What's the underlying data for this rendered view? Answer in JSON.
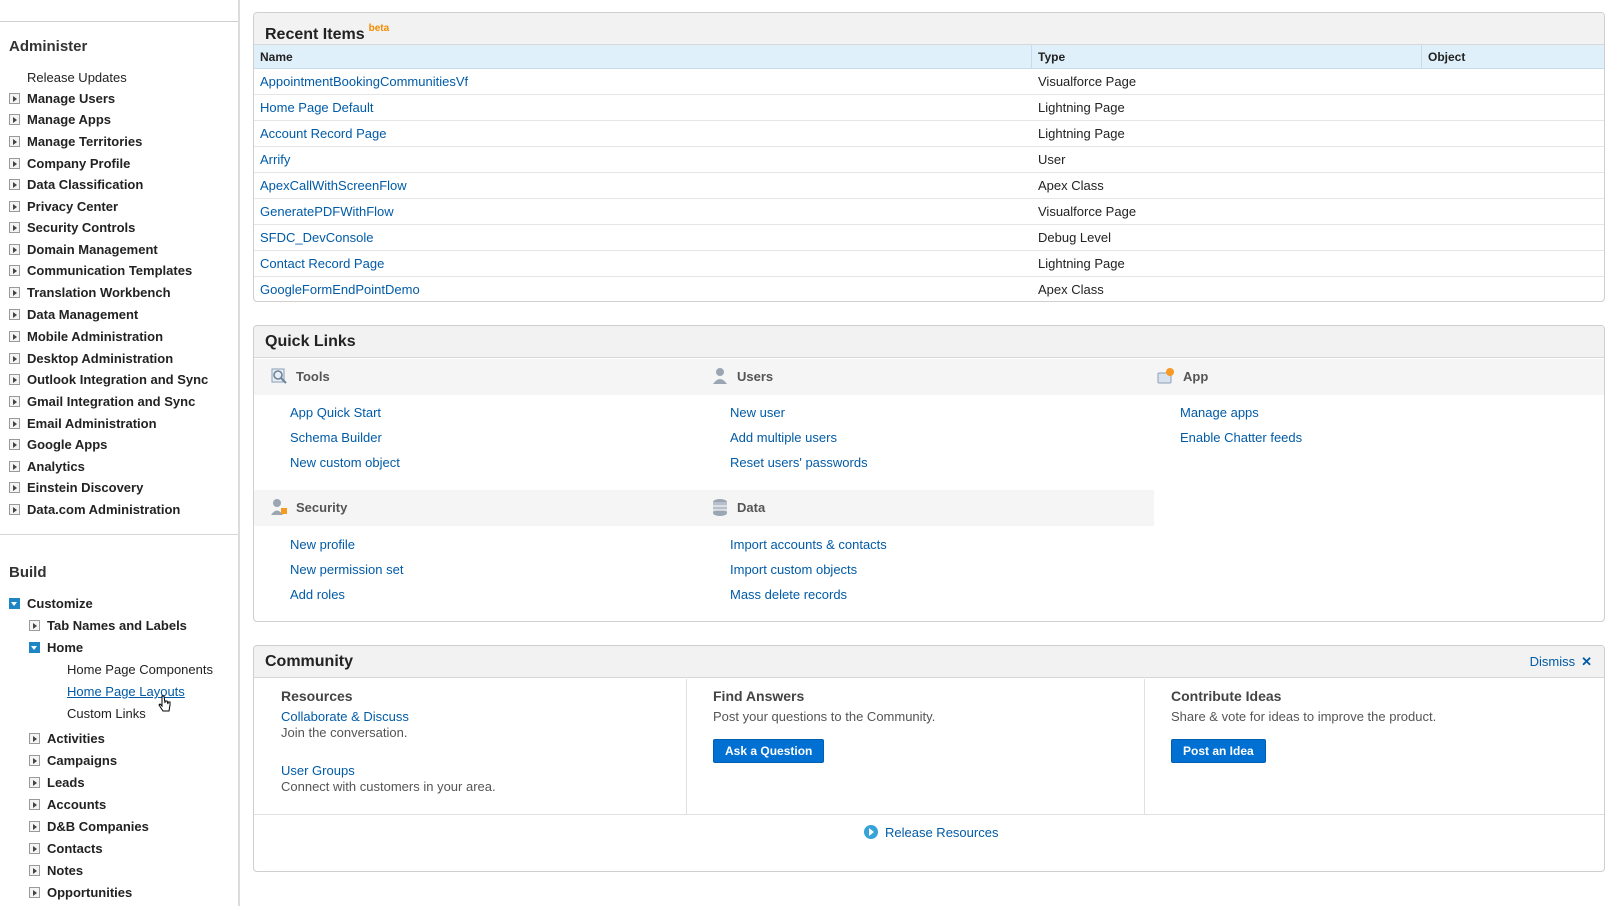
{
  "sidebar": {
    "administer_heading": "Administer",
    "administer_items": [
      {
        "label": "Release Updates",
        "toggle": false
      },
      {
        "label": "Manage Users",
        "toggle": true
      },
      {
        "label": "Manage Apps",
        "toggle": true
      },
      {
        "label": "Manage Territories",
        "toggle": true
      },
      {
        "label": "Company Profile",
        "toggle": true
      },
      {
        "label": "Data Classification",
        "toggle": true
      },
      {
        "label": "Privacy Center",
        "toggle": true
      },
      {
        "label": "Security Controls",
        "toggle": true
      },
      {
        "label": "Domain Management",
        "toggle": true
      },
      {
        "label": "Communication Templates",
        "toggle": true
      },
      {
        "label": "Translation Workbench",
        "toggle": true
      },
      {
        "label": "Data Management",
        "toggle": true
      },
      {
        "label": "Mobile Administration",
        "toggle": true
      },
      {
        "label": "Desktop Administration",
        "toggle": true
      },
      {
        "label": "Outlook Integration and Sync",
        "toggle": true
      },
      {
        "label": "Gmail Integration and Sync",
        "toggle": true
      },
      {
        "label": "Email Administration",
        "toggle": true
      },
      {
        "label": "Google Apps",
        "toggle": true
      },
      {
        "label": "Analytics",
        "toggle": true
      },
      {
        "label": "Einstein Discovery",
        "toggle": true
      },
      {
        "label": "Data.com Administration",
        "toggle": true
      }
    ],
    "build_heading": "Build",
    "customize_label": "Customize",
    "tab_names_label": "Tab Names and Labels",
    "home_label": "Home",
    "home_children": [
      "Home Page Components",
      "Home Page Layouts",
      "Custom Links"
    ],
    "build_children": [
      "Activities",
      "Campaigns",
      "Leads",
      "Accounts",
      "D&B Companies",
      "Contacts",
      "Notes",
      "Opportunities"
    ]
  },
  "recent": {
    "title": "Recent Items",
    "beta": "beta",
    "columns": [
      "Name",
      "Type",
      "Object"
    ],
    "rows": [
      {
        "name": "AppointmentBookingCommunitiesVf",
        "type": "Visualforce Page",
        "object": ""
      },
      {
        "name": "Home Page Default",
        "type": "Lightning Page",
        "object": ""
      },
      {
        "name": "Account Record Page",
        "type": "Lightning Page",
        "object": ""
      },
      {
        "name": "Arrify",
        "type": "User",
        "object": ""
      },
      {
        "name": "ApexCallWithScreenFlow",
        "type": "Apex Class",
        "object": ""
      },
      {
        "name": "GeneratePDFWithFlow",
        "type": "Visualforce Page",
        "object": ""
      },
      {
        "name": "SFDC_DevConsole",
        "type": "Debug Level",
        "object": ""
      },
      {
        "name": "Contact Record Page",
        "type": "Lightning Page",
        "object": ""
      },
      {
        "name": "GoogleFormEndPointDemo",
        "type": "Apex Class",
        "object": ""
      }
    ]
  },
  "quick": {
    "title": "Quick Links",
    "tools": {
      "label": "Tools",
      "icon": "tools-icon",
      "links": [
        "App Quick Start",
        "Schema Builder",
        "New custom object"
      ]
    },
    "users": {
      "label": "Users",
      "icon": "user-icon",
      "links": [
        "New user",
        "Add multiple users",
        "Reset users' passwords"
      ]
    },
    "app": {
      "label": "App",
      "icon": "app-icon",
      "links": [
        "Manage apps",
        "Enable Chatter feeds"
      ]
    },
    "security": {
      "label": "Security",
      "icon": "security-icon",
      "links": [
        "New profile",
        "New permission set",
        "Add roles"
      ]
    },
    "data": {
      "label": "Data",
      "icon": "database-icon",
      "links": [
        "Import accounts & contacts",
        "Import custom objects",
        "Mass delete records"
      ]
    }
  },
  "community": {
    "title": "Community",
    "dismiss": "Dismiss",
    "dismiss_x": "✕",
    "resources": {
      "title": "Resources",
      "link1": "Collaborate & Discuss",
      "text1": "Join the conversation.",
      "link2": "User Groups",
      "text2": "Connect with customers in your area."
    },
    "find": {
      "title": "Find Answers",
      "text": "Post your questions to the Community.",
      "button": "Ask a Question"
    },
    "ideas": {
      "title": "Contribute Ideas",
      "text": "Share & vote for ideas to improve the product.",
      "button": "Post an Idea"
    },
    "release": "Release Resources"
  },
  "colors": {
    "link": "#015ba7",
    "button": "#0070d2",
    "beta": "#f28b00",
    "header_row": "#dff0fb"
  }
}
